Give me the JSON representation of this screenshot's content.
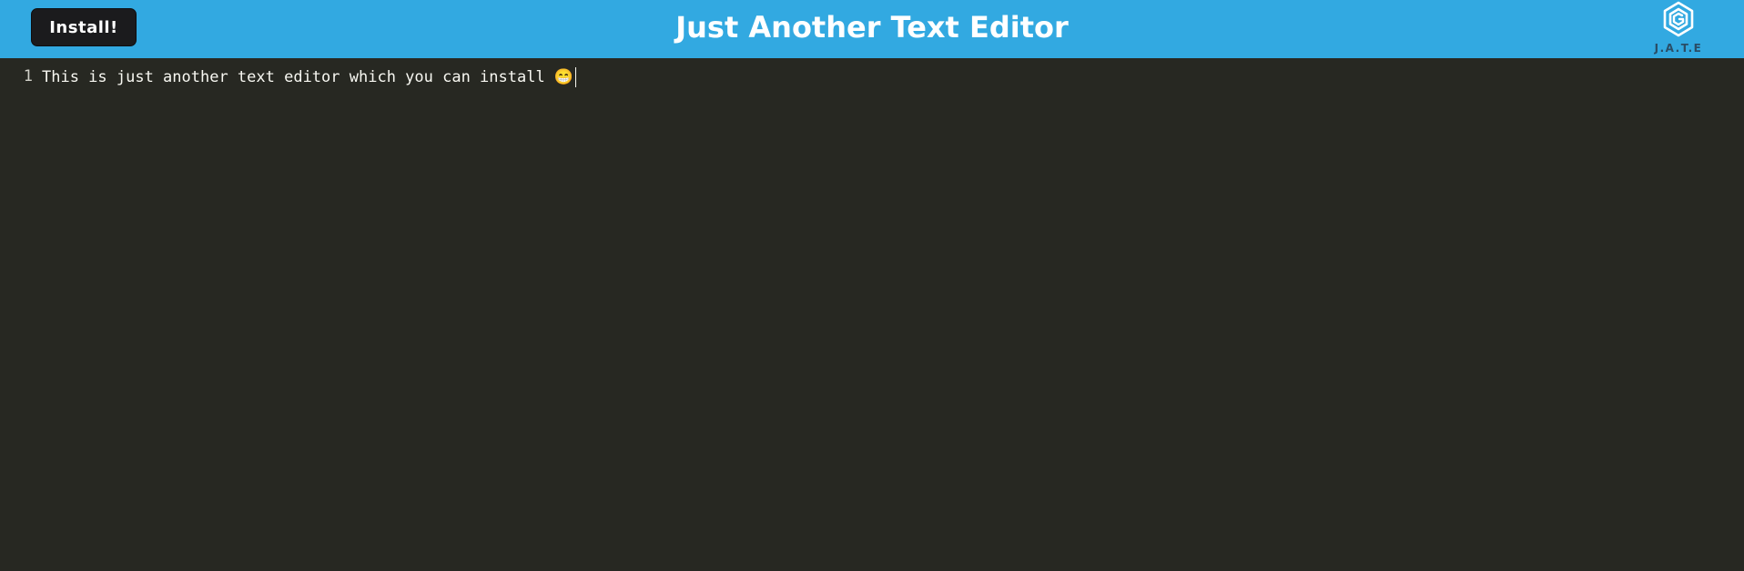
{
  "header": {
    "install_label": "Install!",
    "title": "Just Another Text Editor",
    "logo_text": "J.A.T.E"
  },
  "editor": {
    "line_numbers": [
      "1"
    ],
    "lines": [
      "This is just another text editor which you can install 😁"
    ]
  },
  "colors": {
    "header_bg": "#32a9e1",
    "editor_bg": "#272822",
    "button_bg": "#1b1b1d",
    "text": "#f8f8f2"
  },
  "icons": {
    "logo": "jate-logo-icon"
  }
}
